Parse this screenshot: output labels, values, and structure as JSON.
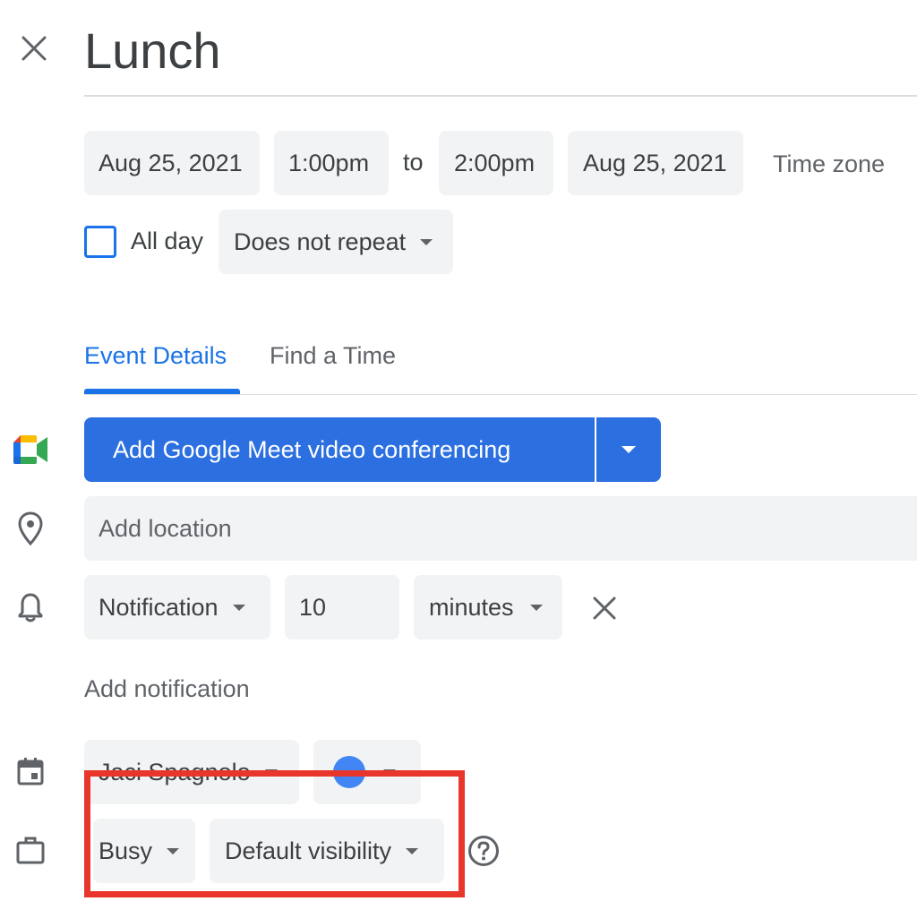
{
  "header": {
    "title": "Lunch"
  },
  "datetime": {
    "start_date": "Aug 25, 2021",
    "start_time": "1:00pm",
    "separator": "to",
    "end_time": "2:00pm",
    "end_date": "Aug 25, 2021",
    "timezone_label": "Time zone"
  },
  "allday": {
    "label": "All day",
    "checked": false,
    "repeat_value": "Does not repeat"
  },
  "tabs": [
    {
      "label": "Event Details",
      "active": true
    },
    {
      "label": "Find a Time",
      "active": false
    }
  ],
  "meet": {
    "button_label": "Add Google Meet video conferencing"
  },
  "location": {
    "placeholder": "Add location"
  },
  "notification": {
    "type": "Notification",
    "amount": "10",
    "unit": "minutes",
    "add_label": "Add notification"
  },
  "calendar": {
    "owner": "Jaci Spagnolo",
    "color": "#4285f4"
  },
  "availability": {
    "status": "Busy",
    "visibility": "Default visibility"
  },
  "colors": {
    "accent": "#1a73e8",
    "primary_button": "#2c6fe0",
    "highlight_box": "#e8362c",
    "chip_bg": "#f1f3f4"
  },
  "icons": [
    "close-icon",
    "google-meet-icon",
    "location-pin-icon",
    "bell-icon",
    "calendar-icon",
    "briefcase-icon",
    "help-icon",
    "dropdown-caret-icon"
  ]
}
